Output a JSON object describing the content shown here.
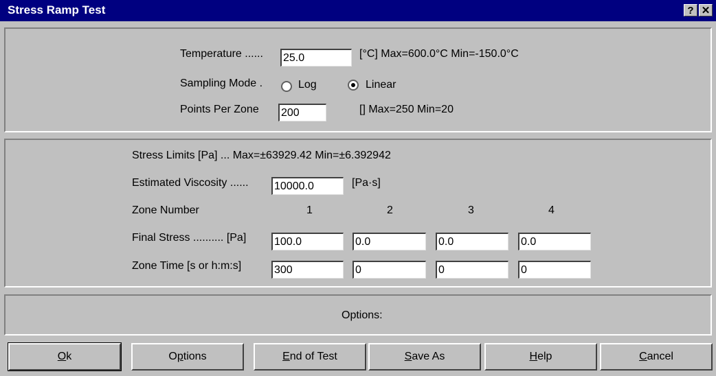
{
  "window": {
    "title": "Stress Ramp Test",
    "help_glyph": "?",
    "close_glyph": "✕"
  },
  "general": {
    "temperature_label": "Temperature ......",
    "temperature_value": "25.0",
    "temperature_limits": "[°C] Max=600.0°C  Min=-150.0°C",
    "sampling_mode_label": "Sampling Mode .",
    "sampling_options": [
      {
        "label": "Log",
        "selected": false
      },
      {
        "label": "Linear",
        "selected": true
      }
    ],
    "points_label": "Points Per Zone",
    "points_value": "200",
    "points_limits": "[] Max=250 Min=20"
  },
  "zones": {
    "stress_limits": "Stress Limits [Pa] ... Max=±63929.42  Min=±6.392942",
    "viscosity_label": "Estimated Viscosity ......",
    "viscosity_value": "10000.0",
    "viscosity_unit": "[Pa·s]",
    "zone_number_label": "Zone Number",
    "zone_numbers": [
      "1",
      "2",
      "3",
      "4"
    ],
    "final_stress_label": "Final Stress .......... [Pa]",
    "final_stress_values": [
      "100.0",
      "0.0",
      "0.0",
      "0.0"
    ],
    "zone_time_label": "Zone Time   [s or h:m:s]",
    "zone_time_values": [
      "300",
      "0",
      "0",
      "0"
    ]
  },
  "options_panel": {
    "label": "Options:"
  },
  "buttons": {
    "ok": {
      "pre": "",
      "key": "O",
      "post": "k"
    },
    "options": {
      "pre": "O",
      "key": "p",
      "post": "tions"
    },
    "end_of_test": {
      "pre": "",
      "key": "E",
      "post": "nd of Test"
    },
    "save_as": {
      "pre": "",
      "key": "S",
      "post": "ave As"
    },
    "help": {
      "pre": "",
      "key": "H",
      "post": "elp"
    },
    "cancel": {
      "pre": "",
      "key": "C",
      "post": "ancel"
    }
  }
}
